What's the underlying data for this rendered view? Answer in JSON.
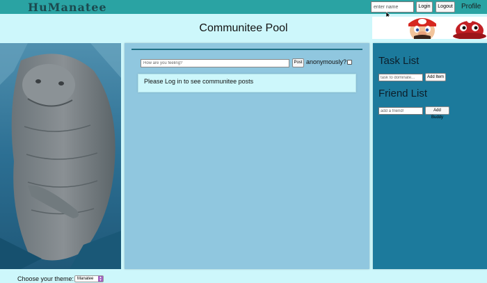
{
  "navbar": {
    "brand": "HuManatee",
    "name_placeholder": "enter name",
    "login_label": "Login",
    "logout_label": "Logout",
    "profile_label": "Profile"
  },
  "page": {
    "title": "Communitee Pool"
  },
  "center": {
    "feeling_placeholder": "How are you feeling?",
    "post_label": "Post",
    "anonymous_label": "anonymously?",
    "posts_message": "Please Log in to see communitee posts"
  },
  "sidebar": {
    "task_heading": "Task List",
    "task_placeholder": "task to dominate...",
    "add_item_label": "Add Item",
    "friend_heading": "Friend List",
    "friend_placeholder": "add a friend!",
    "add_buddy_label": "Add Buddy"
  },
  "footer": {
    "theme_label": "Choose your theme:",
    "theme_value": "Manatee"
  },
  "colors": {
    "navbar": "#2aa3a3",
    "background": "#cdf7fb",
    "center_panel": "#90c7df",
    "right_panel": "#1c7a9c"
  }
}
